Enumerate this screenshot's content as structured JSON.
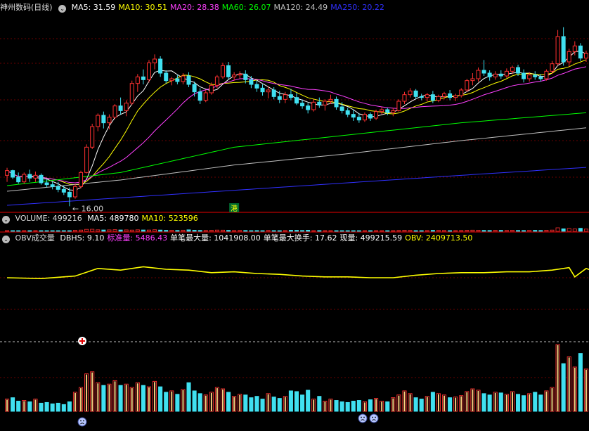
{
  "main_panel": {
    "title": "神州数码(日线)",
    "indicators": [
      {
        "label": "MA5:",
        "value": "31.59",
        "color": "#ffffff"
      },
      {
        "label": "MA10:",
        "value": "30.51",
        "color": "#ffff00"
      },
      {
        "label": "MA20:",
        "value": "28.38",
        "color": "#ff40ff"
      },
      {
        "label": "MA60:",
        "value": "26.07",
        "color": "#00ff00"
      },
      {
        "label": "MA120:",
        "value": "24.49",
        "color": "#c0c0c0"
      },
      {
        "label": "MA250:",
        "value": "20.22",
        "color": "#3030ff"
      }
    ],
    "low_marker": "16.00",
    "badge": "港"
  },
  "volume_panel": {
    "title": "VOLUME:",
    "title_value": "499216",
    "indicators": [
      {
        "label": "MA5:",
        "value": "489780",
        "color": "#ffffff"
      },
      {
        "label": "MA10:",
        "value": "523596",
        "color": "#ffff00"
      }
    ]
  },
  "obv_panel": {
    "title": "OBV成交量",
    "indicators": [
      {
        "label": "DBHS:",
        "value": "9.10",
        "color": "#ffffff"
      },
      {
        "label": "标准量:",
        "value": "5486.43",
        "color": "#ff40ff"
      },
      {
        "label": "单笔最大量:",
        "value": "1041908.00",
        "color": "#ffffff"
      },
      {
        "label": "单笔最大换手:",
        "value": "17.62",
        "color": "#ffffff"
      },
      {
        "label": "现量:",
        "value": "499215.59",
        "color": "#ffffff"
      },
      {
        "label": "OBV:",
        "value": "2409713.50",
        "color": "#ffff00"
      }
    ]
  },
  "colors": {
    "up": "#ff3030",
    "down": "#40e0f0",
    "obv": "#ffff00",
    "grid": "#6a0000",
    "sep": "#9a0000"
  },
  "chart_data": {
    "type": "candlestick",
    "y_price_range": [
      15.5,
      36.5
    ],
    "candles": [
      [
        19.3,
        20.1,
        18.6,
        19.8
      ],
      [
        19.8,
        19.9,
        18.9,
        19.1
      ],
      [
        19.1,
        19.6,
        18.4,
        18.6
      ],
      [
        18.6,
        19.6,
        18.4,
        19.4
      ],
      [
        19.4,
        19.9,
        18.6,
        19.0
      ],
      [
        19.0,
        19.7,
        18.6,
        19.3
      ],
      [
        19.3,
        19.5,
        18.3,
        18.5
      ],
      [
        18.5,
        18.9,
        18.0,
        18.3
      ],
      [
        18.3,
        18.6,
        17.8,
        18.1
      ],
      [
        18.1,
        18.6,
        17.5,
        17.8
      ],
      [
        17.8,
        18.2,
        17.2,
        17.5
      ],
      [
        17.5,
        18.0,
        16.0,
        17.0
      ],
      [
        17.0,
        18.4,
        16.8,
        18.1
      ],
      [
        18.1,
        19.8,
        17.9,
        19.6
      ],
      [
        19.6,
        22.6,
        19.5,
        22.3
      ],
      [
        22.3,
        24.8,
        22.1,
        24.5
      ],
      [
        24.5,
        25.9,
        24.0,
        25.7
      ],
      [
        25.7,
        26.1,
        24.3,
        24.9
      ],
      [
        24.9,
        25.8,
        24.2,
        25.5
      ],
      [
        25.5,
        26.9,
        25.3,
        26.7
      ],
      [
        26.7,
        27.6,
        25.8,
        26.2
      ],
      [
        26.2,
        27.3,
        25.6,
        27.0
      ],
      [
        27.0,
        29.4,
        26.8,
        29.1
      ],
      [
        29.1,
        30.1,
        28.2,
        29.8
      ],
      [
        29.8,
        30.6,
        29.0,
        29.5
      ],
      [
        29.5,
        31.6,
        29.2,
        31.3
      ],
      [
        31.3,
        32.2,
        30.6,
        31.7
      ],
      [
        31.7,
        32.0,
        29.8,
        30.2
      ],
      [
        30.2,
        30.5,
        29.1,
        29.4
      ],
      [
        29.4,
        29.8,
        28.9,
        29.6
      ],
      [
        29.6,
        30.0,
        29.0,
        29.3
      ],
      [
        29.3,
        30.2,
        29.0,
        29.9
      ],
      [
        29.9,
        30.3,
        28.7,
        29.0
      ],
      [
        29.0,
        29.3,
        27.7,
        28.2
      ],
      [
        28.2,
        28.6,
        26.9,
        27.3
      ],
      [
        27.3,
        28.4,
        27.1,
        28.1
      ],
      [
        28.1,
        29.2,
        27.9,
        28.9
      ],
      [
        28.9,
        30.0,
        28.6,
        29.8
      ],
      [
        29.8,
        31.3,
        29.6,
        31.0
      ],
      [
        31.0,
        31.4,
        29.5,
        29.8
      ],
      [
        29.8,
        30.3,
        29.4,
        30.0
      ],
      [
        30.0,
        30.4,
        29.6,
        30.1
      ],
      [
        30.1,
        30.5,
        29.1,
        29.5
      ],
      [
        29.5,
        29.9,
        28.6,
        29.0
      ],
      [
        29.0,
        29.4,
        28.2,
        28.6
      ],
      [
        28.6,
        29.0,
        27.8,
        28.2
      ],
      [
        28.2,
        28.8,
        27.5,
        28.4
      ],
      [
        28.4,
        28.7,
        27.4,
        27.7
      ],
      [
        27.7,
        28.3,
        27.0,
        27.4
      ],
      [
        27.4,
        28.2,
        27.0,
        27.9
      ],
      [
        27.9,
        28.5,
        27.3,
        27.6
      ],
      [
        27.6,
        28.1,
        26.8,
        27.0
      ],
      [
        27.0,
        27.4,
        26.4,
        26.7
      ],
      [
        26.7,
        27.0,
        25.9,
        26.3
      ],
      [
        26.3,
        27.4,
        26.1,
        27.1
      ],
      [
        27.1,
        27.6,
        26.5,
        26.8
      ],
      [
        26.8,
        27.4,
        26.2,
        27.2
      ],
      [
        27.2,
        27.9,
        26.9,
        27.4
      ],
      [
        27.4,
        27.7,
        26.3,
        26.6
      ],
      [
        26.6,
        27.1,
        25.9,
        26.2
      ],
      [
        26.2,
        26.5,
        25.5,
        25.8
      ],
      [
        25.8,
        26.3,
        25.1,
        25.5
      ],
      [
        25.5,
        25.9,
        24.9,
        25.2
      ],
      [
        25.2,
        26.0,
        25.0,
        25.8
      ],
      [
        25.8,
        26.0,
        25.1,
        25.4
      ],
      [
        25.4,
        26.3,
        25.2,
        26.1
      ],
      [
        26.1,
        26.6,
        25.8,
        26.3
      ],
      [
        26.3,
        26.5,
        25.7,
        26.0
      ],
      [
        26.0,
        26.5,
        25.6,
        26.2
      ],
      [
        26.2,
        27.4,
        26.1,
        27.2
      ],
      [
        27.2,
        28.2,
        26.9,
        27.9
      ],
      [
        27.9,
        28.6,
        27.6,
        28.3
      ],
      [
        28.3,
        28.5,
        27.4,
        27.7
      ],
      [
        27.7,
        28.0,
        27.3,
        27.6
      ],
      [
        27.6,
        28.1,
        27.2,
        27.9
      ],
      [
        27.9,
        28.3,
        27.0,
        27.3
      ],
      [
        27.3,
        27.9,
        27.1,
        27.7
      ],
      [
        27.7,
        28.2,
        27.4,
        28.0
      ],
      [
        28.0,
        28.4,
        27.3,
        27.6
      ],
      [
        27.6,
        28.0,
        27.2,
        27.8
      ],
      [
        27.8,
        28.6,
        27.6,
        28.4
      ],
      [
        28.4,
        29.6,
        28.2,
        29.4
      ],
      [
        29.4,
        30.2,
        28.9,
        29.6
      ],
      [
        29.6,
        30.8,
        29.3,
        30.5
      ],
      [
        30.5,
        31.6,
        29.9,
        30.2
      ],
      [
        30.2,
        30.5,
        29.4,
        29.8
      ],
      [
        29.8,
        30.4,
        29.5,
        30.1
      ],
      [
        30.1,
        30.5,
        29.6,
        29.9
      ],
      [
        29.9,
        30.7,
        29.7,
        30.4
      ],
      [
        30.4,
        31.0,
        30.1,
        30.8
      ],
      [
        30.8,
        31.1,
        29.9,
        30.2
      ],
      [
        30.2,
        30.6,
        29.2,
        29.6
      ],
      [
        29.6,
        30.3,
        29.3,
        30.0
      ],
      [
        30.0,
        30.4,
        29.5,
        29.8
      ],
      [
        29.8,
        30.1,
        29.3,
        29.6
      ],
      [
        29.6,
        30.6,
        29.4,
        30.4
      ],
      [
        30.4,
        31.5,
        30.1,
        31.2
      ],
      [
        31.2,
        34.8,
        31.0,
        34.1
      ],
      [
        34.1,
        35.1,
        31.0,
        31.4
      ],
      [
        31.4,
        32.8,
        30.9,
        32.5
      ],
      [
        32.5,
        33.6,
        32.1,
        33.1
      ],
      [
        33.1,
        33.4,
        31.5,
        31.8
      ],
      [
        31.8,
        32.6,
        31.4,
        32.3
      ]
    ],
    "ma_series": [
      {
        "name": "MA5",
        "start": 4,
        "end": 31.59,
        "color": "#ffffff"
      },
      {
        "name": "MA10",
        "start": 9,
        "end": 30.51,
        "color": "#ffff00"
      },
      {
        "name": "MA20",
        "start": 19,
        "end": 28.38,
        "color": "#ff40ff"
      },
      {
        "name": "MA60",
        "anchors": [
          [
            0,
            18.2
          ],
          [
            20,
            19.6
          ],
          [
            40,
            22.3
          ],
          [
            60,
            23.6
          ],
          [
            80,
            24.9
          ],
          [
            104,
            26.07
          ]
        ],
        "color": "#00ff00"
      },
      {
        "name": "MA120",
        "anchors": [
          [
            0,
            17.6
          ],
          [
            20,
            18.8
          ],
          [
            40,
            20.4
          ],
          [
            60,
            21.6
          ],
          [
            80,
            23.0
          ],
          [
            104,
            24.49
          ]
        ],
        "color": "#c0c0c0"
      },
      {
        "name": "MA250",
        "anchors": [
          [
            0,
            16.1
          ],
          [
            20,
            16.9
          ],
          [
            40,
            17.7
          ],
          [
            60,
            18.5
          ],
          [
            80,
            19.3
          ],
          [
            104,
            20.22
          ]
        ],
        "color": "#3030ff"
      }
    ],
    "obv_line": [
      [
        0,
        0.57
      ],
      [
        6,
        0.56
      ],
      [
        12,
        0.59
      ],
      [
        16,
        0.68
      ],
      [
        20,
        0.66
      ],
      [
        24,
        0.7
      ],
      [
        28,
        0.67
      ],
      [
        32,
        0.66
      ],
      [
        36,
        0.63
      ],
      [
        40,
        0.64
      ],
      [
        44,
        0.62
      ],
      [
        48,
        0.61
      ],
      [
        52,
        0.59
      ],
      [
        56,
        0.58
      ],
      [
        60,
        0.58
      ],
      [
        64,
        0.57
      ],
      [
        68,
        0.57
      ],
      [
        72,
        0.6
      ],
      [
        76,
        0.62
      ],
      [
        80,
        0.63
      ],
      [
        84,
        0.63
      ],
      [
        88,
        0.64
      ],
      [
        92,
        0.64
      ],
      [
        96,
        0.66
      ],
      [
        99,
        0.69
      ],
      [
        100,
        0.58
      ],
      [
        102,
        0.68
      ],
      [
        104,
        0.63
      ]
    ],
    "volumes": [
      0.18,
      0.2,
      0.15,
      0.16,
      0.14,
      0.18,
      0.12,
      0.13,
      0.11,
      0.12,
      0.1,
      0.14,
      0.28,
      0.35,
      0.55,
      0.58,
      0.42,
      0.38,
      0.4,
      0.45,
      0.38,
      0.4,
      0.35,
      0.42,
      0.38,
      0.36,
      0.44,
      0.36,
      0.28,
      0.3,
      0.25,
      0.32,
      0.42,
      0.3,
      0.26,
      0.24,
      0.28,
      0.35,
      0.33,
      0.28,
      0.22,
      0.25,
      0.24,
      0.2,
      0.22,
      0.18,
      0.26,
      0.21,
      0.19,
      0.22,
      0.3,
      0.29,
      0.24,
      0.31,
      0.18,
      0.22,
      0.15,
      0.18,
      0.16,
      0.14,
      0.13,
      0.15,
      0.16,
      0.14,
      0.17,
      0.19,
      0.15,
      0.14,
      0.2,
      0.24,
      0.3,
      0.26,
      0.2,
      0.18,
      0.22,
      0.28,
      0.26,
      0.24,
      0.2,
      0.21,
      0.23,
      0.29,
      0.33,
      0.31,
      0.26,
      0.24,
      0.28,
      0.27,
      0.25,
      0.29,
      0.25,
      0.23,
      0.26,
      0.28,
      0.24,
      0.3,
      0.35,
      0.98,
      0.7,
      0.8,
      0.65,
      0.85,
      0.62
    ],
    "volume_ma_top": 0.0,
    "volume_mini_bars_note": "",
    "low_marker_index": 11,
    "badge_index": 40
  }
}
